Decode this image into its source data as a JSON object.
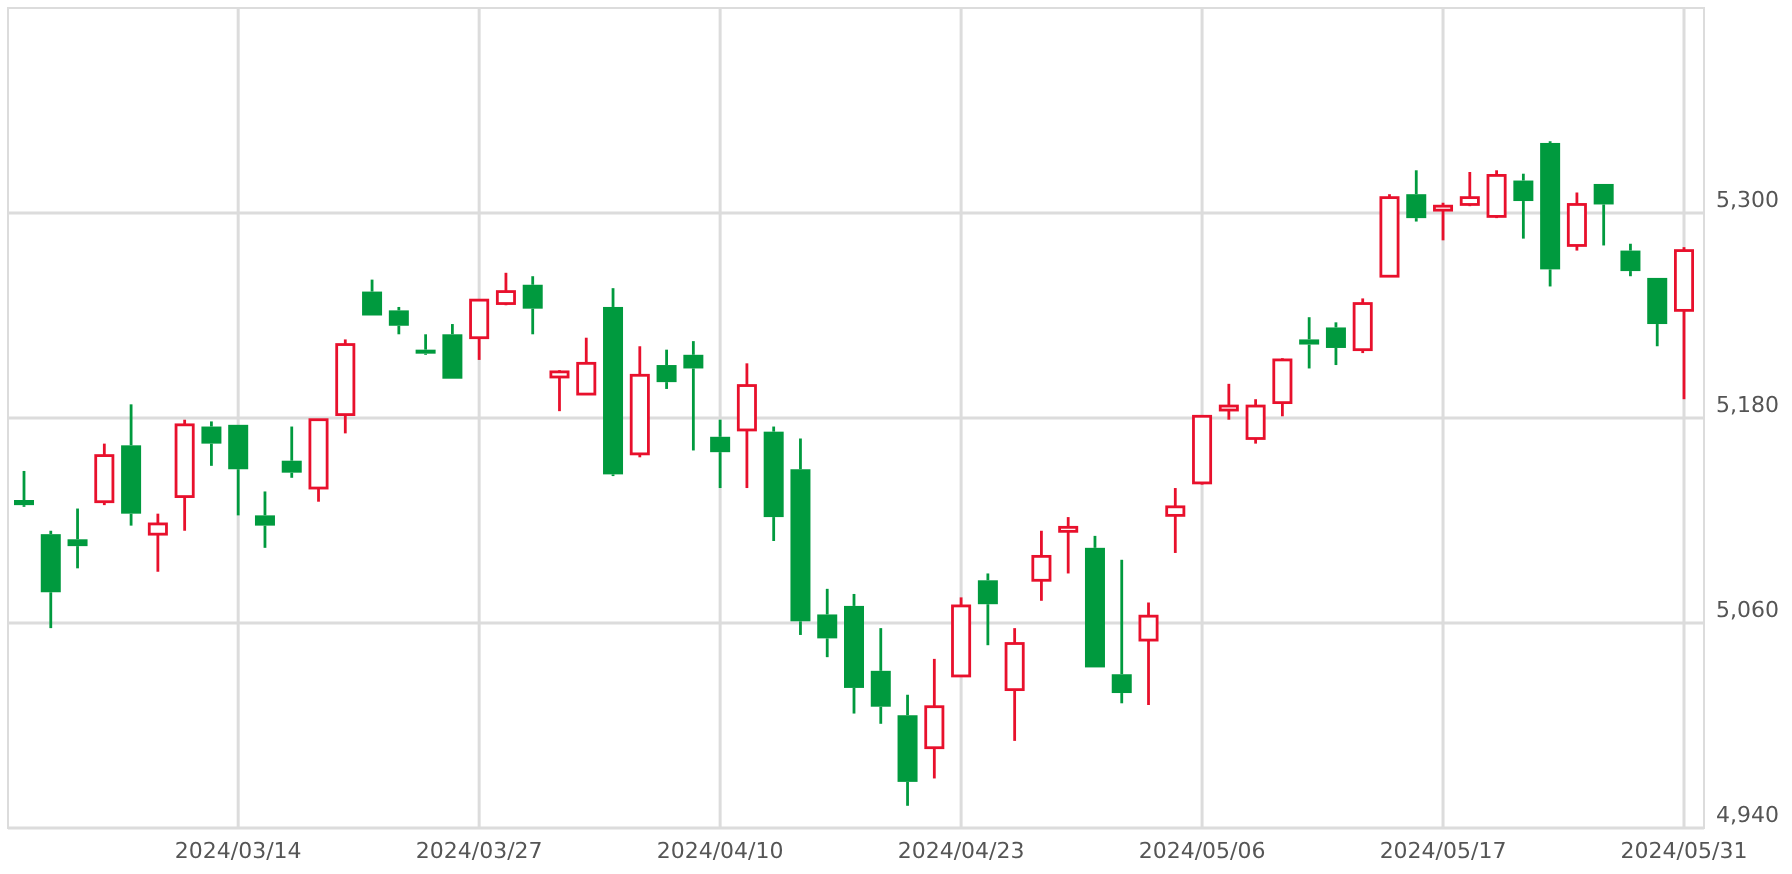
{
  "chart": {
    "chart_data": {
      "type": "candlestick",
      "grid": true,
      "categories": [
        null,
        null,
        null,
        null,
        null,
        null,
        null,
        null,
        "2024/03/14",
        null,
        null,
        null,
        null,
        null,
        null,
        null,
        null,
        "2024/03/27",
        null,
        null,
        null,
        null,
        null,
        null,
        null,
        null,
        "2024/04/10",
        null,
        null,
        null,
        null,
        null,
        null,
        null,
        null,
        "2024/04/23",
        null,
        null,
        null,
        null,
        null,
        null,
        null,
        null,
        "2024/05/06",
        null,
        null,
        null,
        null,
        null,
        null,
        null,
        null,
        "2024/05/17",
        null,
        null,
        null,
        null,
        null,
        null,
        null,
        null,
        "2024/05/31"
      ],
      "ohlc": [
        [
          5132,
          5149,
          5128,
          5129
        ],
        [
          5112,
          5114,
          5057,
          5078
        ],
        [
          5109,
          5127,
          5092,
          5105
        ],
        [
          5131,
          5165,
          5129,
          5158
        ],
        [
          5164,
          5188,
          5117,
          5124
        ],
        [
          5112,
          5124,
          5090,
          5118
        ],
        [
          5134,
          5179,
          5114,
          5176
        ],
        [
          5175,
          5178,
          5152,
          5165
        ],
        [
          5176,
          5176,
          5123,
          5150
        ],
        [
          5123,
          5137,
          5104,
          5117
        ],
        [
          5155,
          5175,
          5145,
          5148
        ],
        [
          5139,
          5179,
          5131,
          5179
        ],
        [
          5182,
          5226,
          5171,
          5223
        ],
        [
          5254,
          5261,
          5240,
          5240
        ],
        [
          5243,
          5245,
          5229,
          5234
        ],
        [
          5220,
          5229,
          5217,
          5218
        ],
        [
          5229,
          5235,
          5203,
          5203
        ],
        [
          5227,
          5249,
          5214,
          5249
        ],
        [
          5247,
          5265,
          5246,
          5254
        ],
        [
          5258,
          5263,
          5229,
          5244
        ],
        [
          5204,
          5208,
          5184,
          5207
        ],
        [
          5194,
          5227,
          5194,
          5212
        ],
        [
          5245,
          5256,
          5146,
          5147
        ],
        [
          5159,
          5222,
          5157,
          5205
        ],
        [
          5211,
          5220,
          5197,
          5201
        ],
        [
          5217,
          5225,
          5161,
          5209
        ],
        [
          5169,
          5179,
          5139,
          5160
        ],
        [
          5173,
          5212,
          5139,
          5199
        ],
        [
          5172,
          5175,
          5108,
          5122
        ],
        [
          5150,
          5168,
          5053,
          5061
        ],
        [
          5065,
          5080,
          5040,
          5051
        ],
        [
          5070,
          5077,
          5007,
          5022
        ],
        [
          5032,
          5057,
          5001,
          5011
        ],
        [
          5006,
          5018,
          4953,
          4967
        ],
        [
          4987,
          5039,
          4969,
          5011
        ],
        [
          5029,
          5075,
          5029,
          5070
        ],
        [
          5085,
          5089,
          5047,
          5071
        ],
        [
          5021,
          5057,
          4991,
          5048
        ],
        [
          5085,
          5114,
          5073,
          5099
        ],
        [
          5114,
          5122,
          5089,
          5116
        ],
        [
          5104,
          5111,
          5034,
          5034
        ],
        [
          5030,
          5097,
          5013,
          5019
        ],
        [
          5050,
          5072,
          5012,
          5064
        ],
        [
          5123,
          5139,
          5101,
          5128
        ],
        [
          5142,
          5181,
          5141,
          5181
        ],
        [
          5186,
          5200,
          5179,
          5187
        ],
        [
          5168,
          5191,
          5165,
          5187
        ],
        [
          5189,
          5215,
          5181,
          5214
        ],
        [
          5226,
          5239,
          5209,
          5223
        ],
        [
          5233,
          5236,
          5211,
          5221
        ],
        [
          5220,
          5250,
          5218,
          5247
        ],
        [
          5263,
          5311,
          5263,
          5309
        ],
        [
          5311,
          5325,
          5295,
          5297
        ],
        [
          5303,
          5306,
          5284,
          5304
        ],
        [
          5305,
          5324,
          5304,
          5309
        ],
        [
          5298,
          5325,
          5297,
          5322
        ],
        [
          5319,
          5323,
          5285,
          5307
        ],
        [
          5341,
          5342,
          5257,
          5267
        ],
        [
          5281,
          5312,
          5278,
          5305
        ],
        [
          5317,
          5317,
          5281,
          5305
        ],
        [
          5278,
          5282,
          5263,
          5266
        ],
        [
          5262,
          5262,
          5222,
          5235
        ],
        [
          5243,
          5280,
          5191,
          5278
        ]
      ],
      "ylim": [
        4940,
        5420
      ],
      "yticks": [
        {
          "value": 4940,
          "label": "4,940"
        },
        {
          "value": 5060,
          "label": "5,060"
        },
        {
          "value": 5180,
          "label": "5,180"
        },
        {
          "value": 5300,
          "label": "5,300"
        }
      ]
    }
  }
}
